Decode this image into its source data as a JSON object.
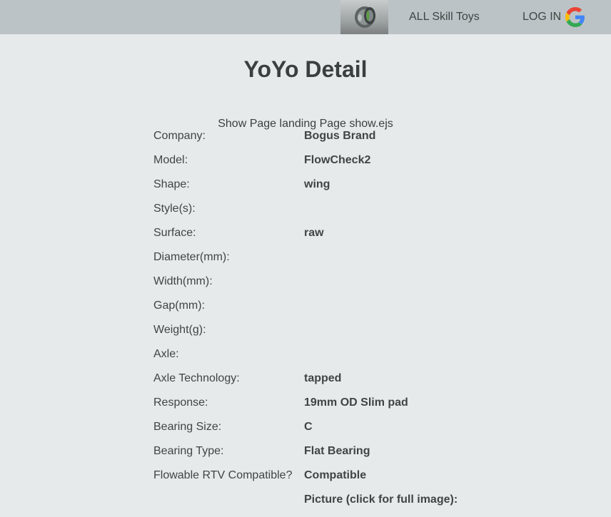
{
  "nav": {
    "thumbnail_icon": "yoyo-thumbnail-icon",
    "skill_toys_link": "ALL Skill Toys",
    "login_label": "LOG IN",
    "login_icon": "google-icon"
  },
  "page": {
    "title": "YoYo Detail",
    "subtitle": "Show Page landing Page show.ejs"
  },
  "details": [
    {
      "label": "Company:",
      "value": "Bogus Brand"
    },
    {
      "label": "Model:",
      "value": "FlowCheck2"
    },
    {
      "label": "Shape:",
      "value": "wing"
    },
    {
      "label": "Style(s):",
      "value": ""
    },
    {
      "label": "Surface:",
      "value": "raw"
    },
    {
      "label": "Diameter(mm):",
      "value": ""
    },
    {
      "label": "Width(mm):",
      "value": ""
    },
    {
      "label": "Gap(mm):",
      "value": ""
    },
    {
      "label": "Weight(g):",
      "value": ""
    },
    {
      "label": "Axle:",
      "value": ""
    },
    {
      "label": "Axle Technology:",
      "value": "tapped"
    },
    {
      "label": "Response:",
      "value": "19mm OD Slim pad"
    },
    {
      "label": "Bearing Size:",
      "value": "C"
    },
    {
      "label": "Bearing Type:",
      "value": "Flat Bearing"
    },
    {
      "label": "Flowable RTV Compatible?",
      "value": "Compatible"
    },
    {
      "label": "",
      "value": "Picture (click for full image):"
    }
  ],
  "colors": {
    "background": "#e7eaea",
    "navbar": "#bcc3c6",
    "text": "#3f4444"
  }
}
